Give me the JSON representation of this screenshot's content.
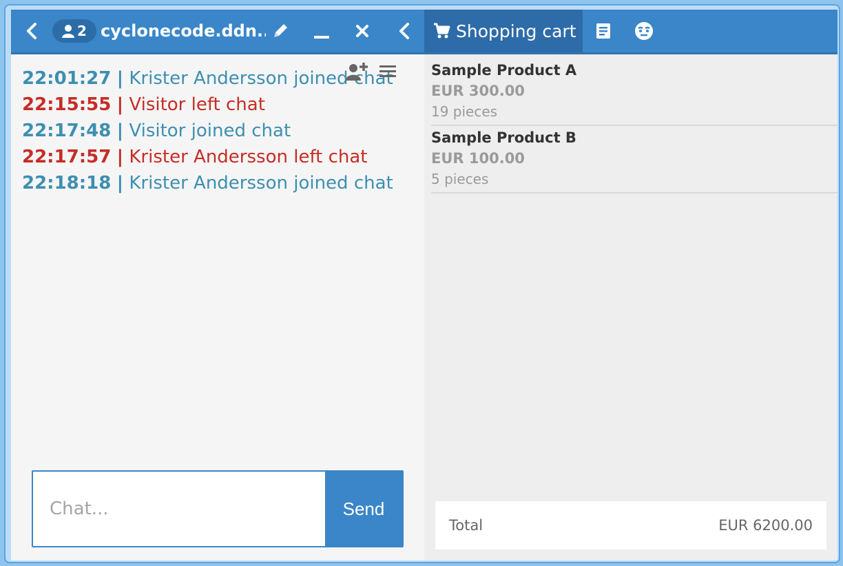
{
  "header": {
    "participant_count": "2",
    "title": "cyclonecode.ddn...",
    "cart_tab_label": "Shopping cart"
  },
  "chat": {
    "messages": [
      {
        "time": "22:01:27",
        "text": "Krister Andersson joined chat",
        "type": "joined"
      },
      {
        "time": "22:15:55",
        "text": "Visitor left chat",
        "type": "left"
      },
      {
        "time": "22:17:48",
        "text": "Visitor joined chat",
        "type": "joined"
      },
      {
        "time": "22:17:57",
        "text": "Krister Andersson left chat",
        "type": "left"
      },
      {
        "time": "22:18:18",
        "text": "Krister Andersson joined chat",
        "type": "joined"
      }
    ],
    "separator": "|",
    "input_placeholder": "Chat...",
    "send_label": "Send"
  },
  "cart": {
    "items": [
      {
        "name": "Sample Product A",
        "price": "EUR 300.00",
        "quantity": "19 pieces"
      },
      {
        "name": "Sample Product B",
        "price": "EUR 100.00",
        "quantity": "5 pieces"
      }
    ],
    "total_label": "Total",
    "total_value": "EUR 6200.00"
  },
  "colors": {
    "topbar": "#3a86c8",
    "joined": "#3d8fb0",
    "left": "#c62d26"
  },
  "icons": [
    "chevron-left-icon",
    "user-icon",
    "pencil-icon",
    "minimize-icon",
    "close-icon",
    "chevron-left-icon",
    "cart-icon",
    "document-icon",
    "face-icon",
    "add-user-icon",
    "menu-icon"
  ]
}
